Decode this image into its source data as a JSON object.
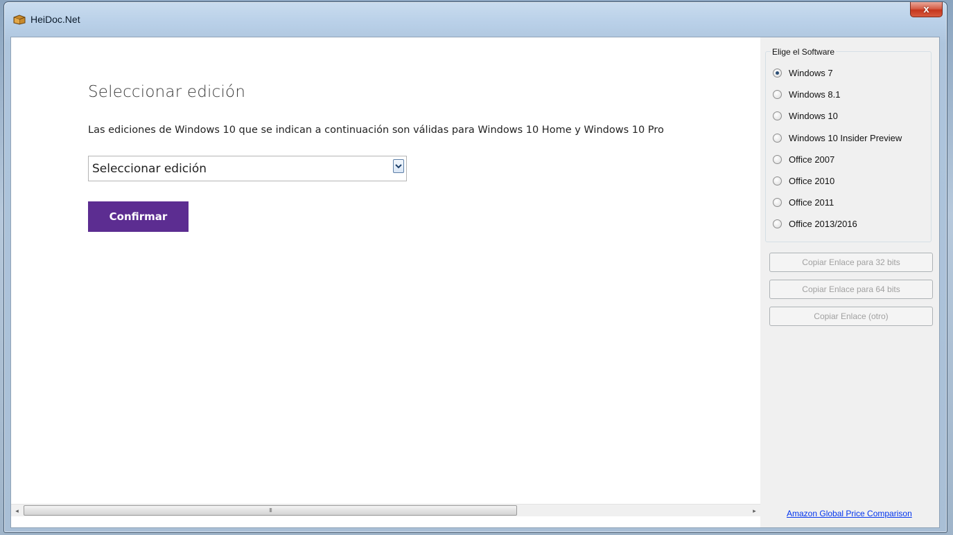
{
  "window": {
    "title": "HeiDoc.Net",
    "close_label": "x"
  },
  "main": {
    "heading": "Seleccionar edición",
    "description": "Las ediciones de Windows 10 que se indican a continuación son válidas para Windows 10 Home y Windows 10 Pro",
    "select_value": "Seleccionar edición",
    "confirm_label": "Confirmar",
    "confirm_color": "#5c2d91",
    "scroll_thumb_grip": "III"
  },
  "side": {
    "group_label": "Elige el Software",
    "options": [
      {
        "label": "Windows 7",
        "checked": true
      },
      {
        "label": "Windows 8.1",
        "checked": false
      },
      {
        "label": "Windows 10",
        "checked": false
      },
      {
        "label": "Windows 10 Insider Preview",
        "checked": false
      },
      {
        "label": "Office 2007",
        "checked": false
      },
      {
        "label": "Office 2010",
        "checked": false
      },
      {
        "label": "Office 2011",
        "checked": false
      },
      {
        "label": "Office 2013/2016",
        "checked": false
      }
    ],
    "buttons": [
      {
        "label": "Copiar Enlace para 32 bits"
      },
      {
        "label": "Copiar Enlace para 64 bits"
      },
      {
        "label": "Copiar Enlace (otro)"
      }
    ],
    "link_label": "Amazon Global Price Comparison"
  }
}
